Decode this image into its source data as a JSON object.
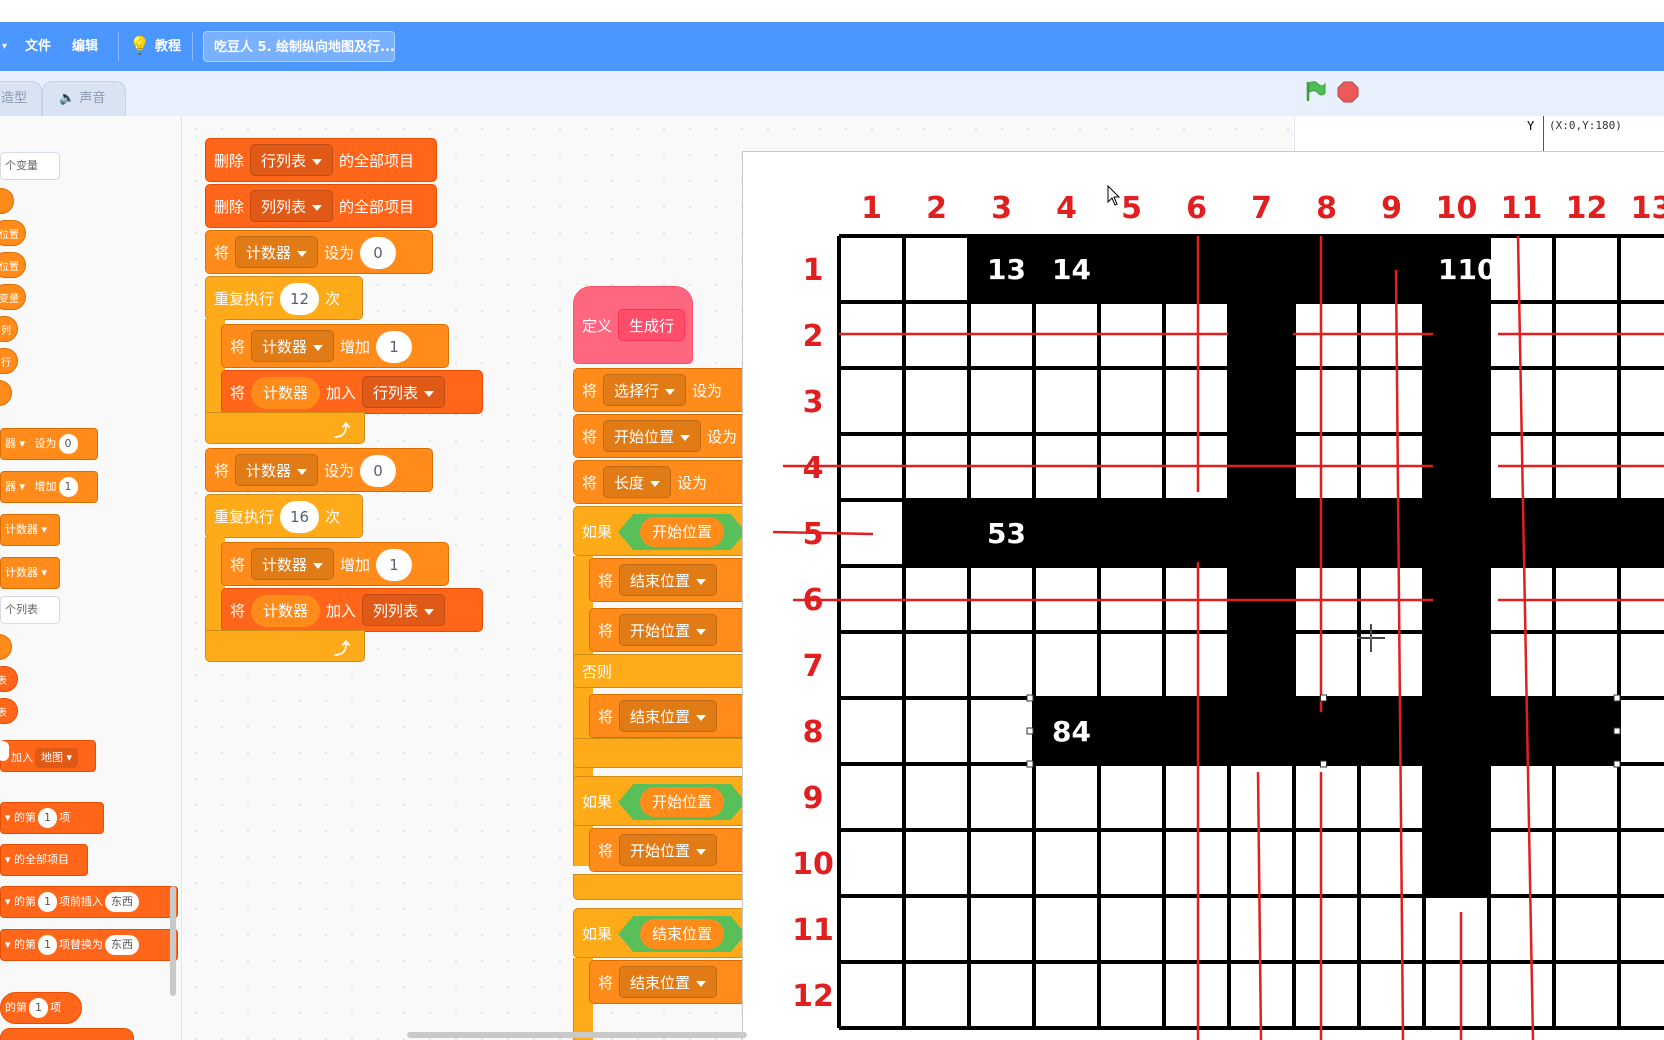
{
  "menubar": {
    "file": "文件",
    "edit": "编辑",
    "tutorials": "教程",
    "project_title": "吃豆人 5. 绘制纵向地图及行..."
  },
  "tabs": {
    "costumes": "造型",
    "sounds": "声音"
  },
  "palette": {
    "make_variable_tail": "个变量",
    "make_list_tail": "个列表",
    "set_tail": "器",
    "set_label": "设为",
    "set_value": "0",
    "change_label": "增加",
    "change_value": "1",
    "var_counter": "计数器",
    "add_label": "加入",
    "list_map": "地图",
    "item_of_label": "的第",
    "item_of_value": "1",
    "item_of_tail": "项",
    "delete_all": "的全部项目",
    "insert_label": "项前插入",
    "insert_thing": "东西",
    "replace_label": "项替换为",
    "replace_thing": "东西",
    "frag_pos1": "位置",
    "frag_pos2": "位置",
    "frag_var": "变量",
    "frag_col": "列",
    "frag_row": "行",
    "frag_table1": "表",
    "frag_table2": "表",
    "frag_item1": "的第",
    "frag_item1_value": "1",
    "frag_item1_tail": "项"
  },
  "script_left": {
    "delete_label": "删除",
    "all_items": "的全部项目",
    "row_list": "行列表",
    "col_list": "列列表",
    "set_label": "将",
    "to_label": "设为",
    "change_by": "增加",
    "add_to": "加入",
    "counter": "计数器",
    "zero": "0",
    "one": "1",
    "repeat_label": "重复执行",
    "repeat_times": "次",
    "repeat_12": "12",
    "repeat_16": "16"
  },
  "script_right": {
    "define": "定义",
    "define_name": "生成行",
    "set_label": "将",
    "to_label": "设为",
    "var_select_row": "选择行",
    "var_start": "开始位置",
    "var_length": "长度",
    "var_end": "结束位置",
    "if_label": "如果",
    "else_label": "否则"
  },
  "stage": {
    "coord_y_label": "Y",
    "coord_readout": "(X:0,Y:180)"
  },
  "overlay": {
    "col_headers": [
      "1",
      "2",
      "3",
      "4",
      "5",
      "6",
      "7",
      "8",
      "9",
      "10",
      "11",
      "12",
      "13"
    ],
    "row_headers": [
      "1",
      "2",
      "3",
      "4",
      "5",
      "6",
      "7",
      "8",
      "9",
      "10",
      "11",
      "12"
    ],
    "cell_labels": [
      "13",
      "14",
      "110",
      "53",
      "84"
    ],
    "filled_cells": [
      [
        1,
        3
      ],
      [
        1,
        4
      ],
      [
        1,
        5
      ],
      [
        1,
        6
      ],
      [
        1,
        7
      ],
      [
        1,
        8
      ],
      [
        1,
        9
      ],
      [
        1,
        10
      ],
      [
        2,
        7
      ],
      [
        2,
        10
      ],
      [
        3,
        7
      ],
      [
        3,
        10
      ],
      [
        4,
        7
      ],
      [
        4,
        10
      ],
      [
        5,
        2
      ],
      [
        5,
        3
      ],
      [
        5,
        4
      ],
      [
        5,
        5
      ],
      [
        5,
        6
      ],
      [
        5,
        7
      ],
      [
        5,
        8
      ],
      [
        5,
        9
      ],
      [
        5,
        10
      ],
      [
        5,
        11
      ],
      [
        5,
        12
      ],
      [
        5,
        13
      ],
      [
        6,
        7
      ],
      [
        6,
        10
      ],
      [
        7,
        7
      ],
      [
        7,
        10
      ],
      [
        8,
        4
      ],
      [
        8,
        5
      ],
      [
        8,
        6
      ],
      [
        8,
        7
      ],
      [
        8,
        8
      ],
      [
        8,
        9
      ],
      [
        8,
        10
      ],
      [
        8,
        11
      ],
      [
        8,
        12
      ],
      [
        9,
        10
      ],
      [
        10,
        10
      ]
    ],
    "colors": {
      "annotation": "#e02020",
      "grid": "#000000"
    }
  },
  "colors": {
    "menubar": "#4c97ff",
    "data_block": "#ff661a",
    "control_block": "#ffab19",
    "define_block": "#ff6680",
    "operator": "#59c059",
    "flag": "#4cbf56",
    "stop": "#ec5959"
  }
}
